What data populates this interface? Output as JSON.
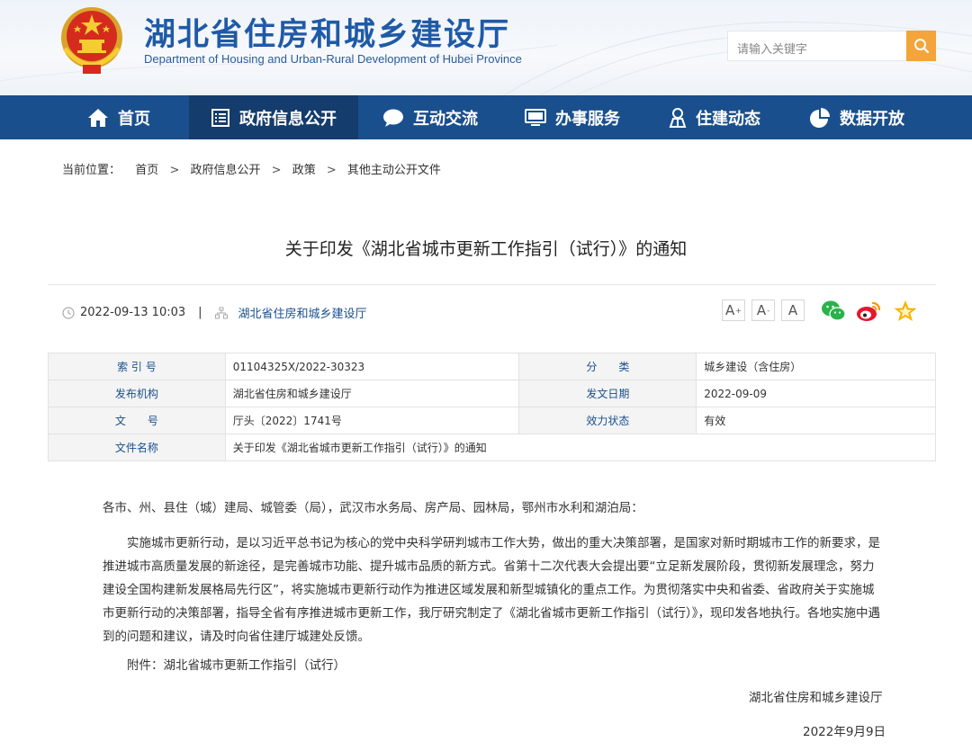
{
  "header": {
    "title": "湖北省住房和城乡建设厅",
    "subtitle": "Department of Housing and Urban-Rural Development of Hubei Province",
    "search_placeholder": "请输入关键字"
  },
  "nav": [
    {
      "label": "首页",
      "icon": "home-icon"
    },
    {
      "label": "政府信息公开",
      "icon": "document-list-icon"
    },
    {
      "label": "互动交流",
      "icon": "chat-bubble-icon"
    },
    {
      "label": "办事服务",
      "icon": "monitor-icon"
    },
    {
      "label": "住建动态",
      "icon": "person-icon"
    },
    {
      "label": "数据开放",
      "icon": "pie-chart-icon"
    }
  ],
  "breadcrumb": {
    "prefix": "当前位置：",
    "items": [
      "首页",
      "政府信息公开",
      "政策",
      "其他主动公开文件"
    ],
    "separator": ">"
  },
  "article": {
    "title": "关于印发《湖北省城市更新工作指引（试行）》的通知",
    "date": "2022-09-13 10:03",
    "divider": "|",
    "source": "湖北省住房和城乡建设厅",
    "font_sizes": [
      "A",
      "A",
      "A"
    ]
  },
  "info": {
    "index_label": "索 引 号",
    "index_value": "01104325X/2022-30323",
    "category_label": "分　　类",
    "category_value": "城乡建设（含住房）",
    "issuer_label": "发布机构",
    "issuer_value": "湖北省住房和城乡建设厅",
    "issue_date_label": "发文日期",
    "issue_date_value": "2022-09-09",
    "doc_no_label": "文　　号",
    "doc_no_value": "厅头〔2022〕1741号",
    "status_label": "效力状态",
    "status_value": "有效",
    "filename_label": "文件名称",
    "filename_value": "关于印发《湖北省城市更新工作指引（试行）》的通知"
  },
  "body": {
    "salutation": "各市、州、县住（城）建局、城管委（局），武汉市水务局、房产局、园林局，鄂州市水利和湖泊局：",
    "paragraph": "实施城市更新行动，是以习近平总书记为核心的党中央科学研判城市工作大势，做出的重大决策部署，是国家对新时期城市工作的新要求，是推进城市高质量发展的新途径，是完善城市功能、提升城市品质的新方式。省第十二次代表大会提出要“立足新发展阶段，贯彻新发展理念，努力建设全国构建新发展格局先行区”，将实施城市更新行动作为推进区域发展和新型城镇化的重点工作。为贯彻落实中央和省委、省政府关于实施城市更新行动的决策部署，指导全省有序推进城市更新工作，我厅研究制定了《湖北省城市更新工作指引（试行）》，现印发各地执行。各地实施中遇到的问题和建议，请及时向省住建厅城建处反馈。",
    "attachment": "附件：湖北省城市更新工作指引（试行）",
    "signature": "湖北省住房和城乡建设厅",
    "sign_date": "2022年9月9日"
  },
  "colors": {
    "brand_blue": "#1a4f8d",
    "active_nav": "#143c6d",
    "search_orange": "#f3a43a",
    "wechat_green": "#2ab24a",
    "weibo_red": "#e6162d",
    "favorite_yellow": "#f5b400"
  }
}
